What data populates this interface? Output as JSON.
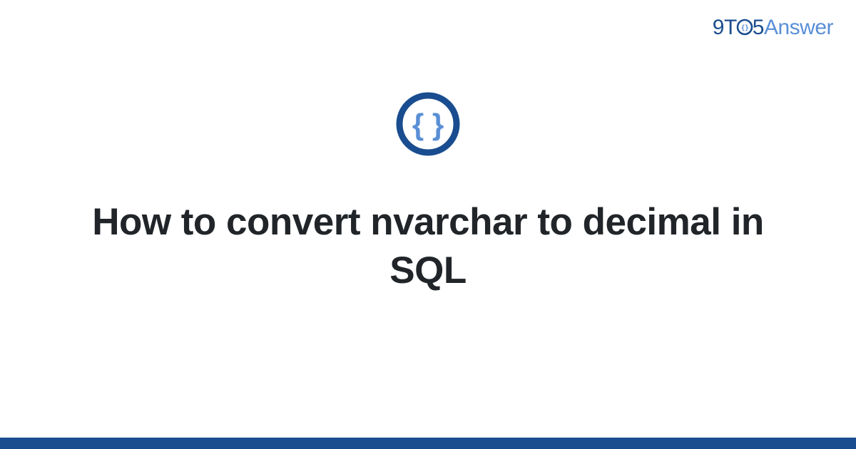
{
  "brand": {
    "part1": "9",
    "part2": "T",
    "part3": "5",
    "part4": "Answer"
  },
  "icon": {
    "name": "code-braces-icon"
  },
  "title": "How to convert nvarchar to decimal in SQL",
  "colors": {
    "dark_blue": "#1a4d8f",
    "light_blue": "#5a8fd6"
  }
}
